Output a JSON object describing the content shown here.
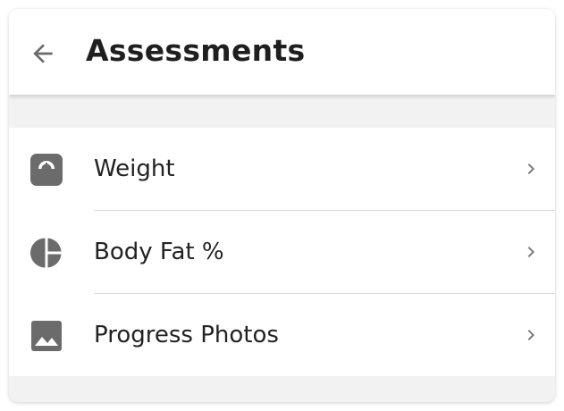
{
  "header": {
    "back_icon": "arrow-left-icon",
    "title": "Assessments"
  },
  "items": [
    {
      "label": "Weight",
      "icon": "scale-icon"
    },
    {
      "label": "Body Fat %",
      "icon": "pie-chart-icon"
    },
    {
      "label": "Progress Photos",
      "icon": "image-icon"
    }
  ],
  "colors": {
    "icon": "#6b6b6b",
    "chevron": "#7a7a7a",
    "background": "#f2f2f2"
  }
}
